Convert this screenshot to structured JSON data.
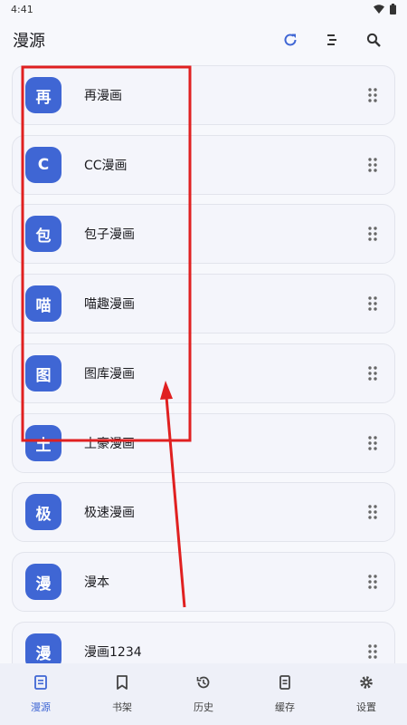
{
  "status_bar": {
    "time": "4:41"
  },
  "app_bar": {
    "title": "漫源"
  },
  "sources": [
    {
      "badge": "再",
      "name": "再漫画"
    },
    {
      "badge": "C",
      "name": "CC漫画"
    },
    {
      "badge": "包",
      "name": "包子漫画"
    },
    {
      "badge": "喵",
      "name": "喵趣漫画"
    },
    {
      "badge": "图",
      "name": "图库漫画"
    },
    {
      "badge": "土",
      "name": "土豪漫画"
    },
    {
      "badge": "极",
      "name": "极速漫画"
    },
    {
      "badge": "漫",
      "name": "漫本"
    },
    {
      "badge": "漫",
      "name": "漫画1234"
    }
  ],
  "bottom_nav": [
    {
      "label": "漫源",
      "icon": "book-icon",
      "active": true
    },
    {
      "label": "书架",
      "icon": "bookmark-icon"
    },
    {
      "label": "历史",
      "icon": "history-icon"
    },
    {
      "label": "缓存",
      "icon": "document-icon"
    },
    {
      "label": "设置",
      "icon": "gear-icon"
    }
  ],
  "colors": {
    "accent": "#3f66d4",
    "annotation": "#e02020"
  }
}
